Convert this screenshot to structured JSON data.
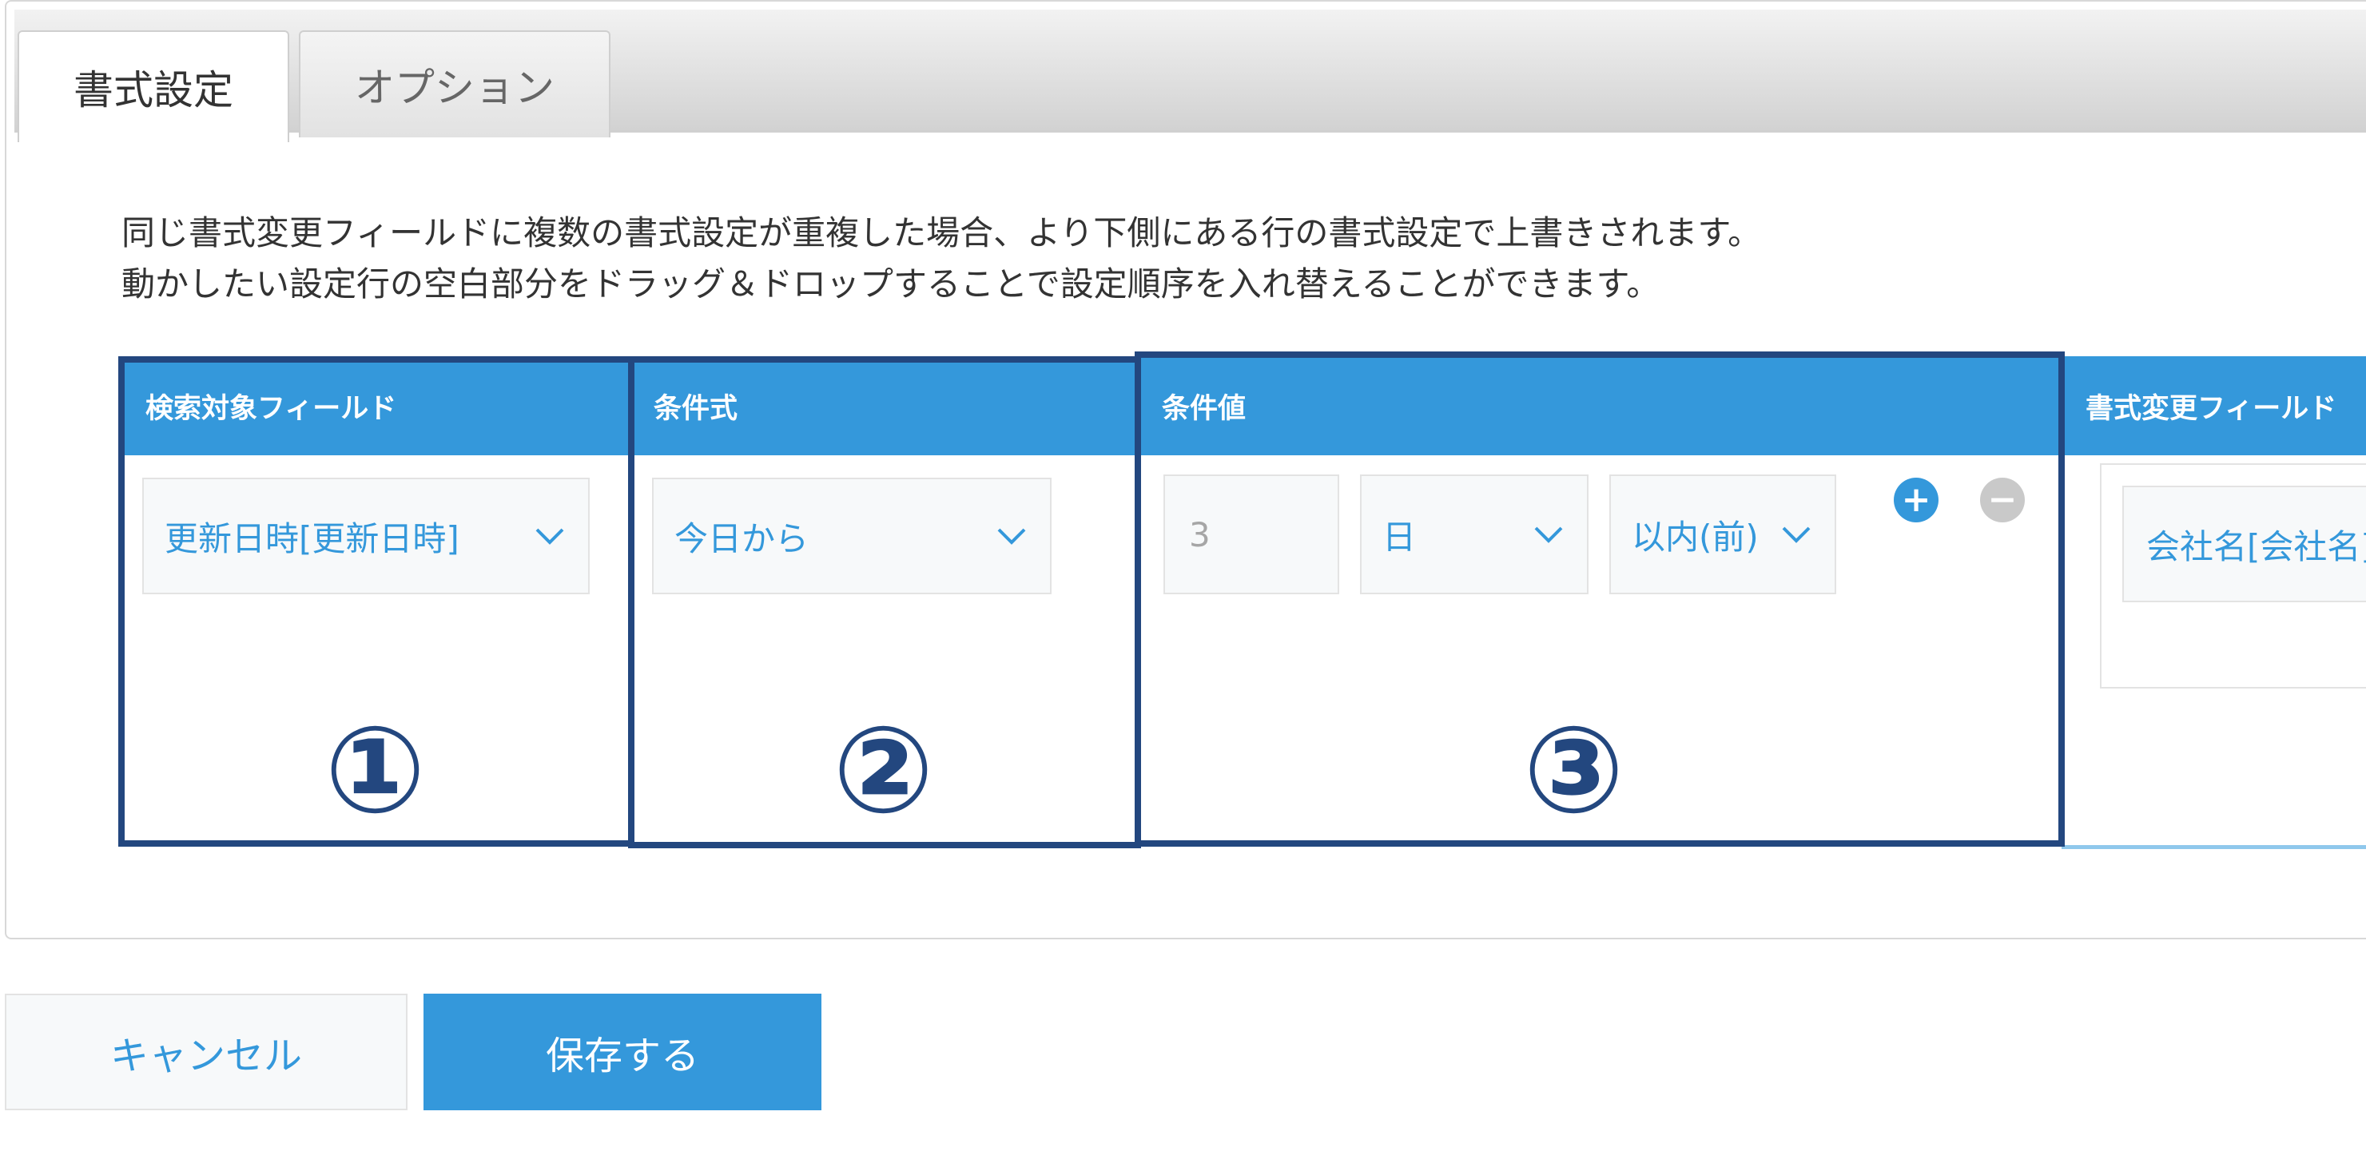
{
  "tabs": [
    {
      "label": "書式設定",
      "active": true
    },
    {
      "label": "オプション",
      "active": false
    }
  ],
  "description": {
    "line1": "同じ書式変更フィールドに複数の書式設定が重複した場合、より下側にある行の書式設定で上書きされます。",
    "line2": "動かしたい設定行の空白部分をドラッグ＆ドロップすることで設定順序を入れ替えることができます。"
  },
  "table": {
    "headers": {
      "search_field": "検索対象フィールド",
      "condition": "条件式",
      "condition_value": "条件値",
      "format_field": "書式変更フィールド"
    },
    "row": {
      "search_field_value": "更新日時[更新日時]",
      "condition_value": "今日から",
      "number_value": "3",
      "unit_value": "日",
      "range_value": "以内(前)",
      "format_field_value": "会社名[会社名]"
    },
    "add_icon": "+",
    "remove_icon": "−"
  },
  "annotations": {
    "one": "①",
    "two": "②",
    "three": "③"
  },
  "buttons": {
    "cancel": "キャンセル",
    "save": "保存する"
  },
  "colors": {
    "accent": "#3498db",
    "annotation": "#23477f"
  }
}
